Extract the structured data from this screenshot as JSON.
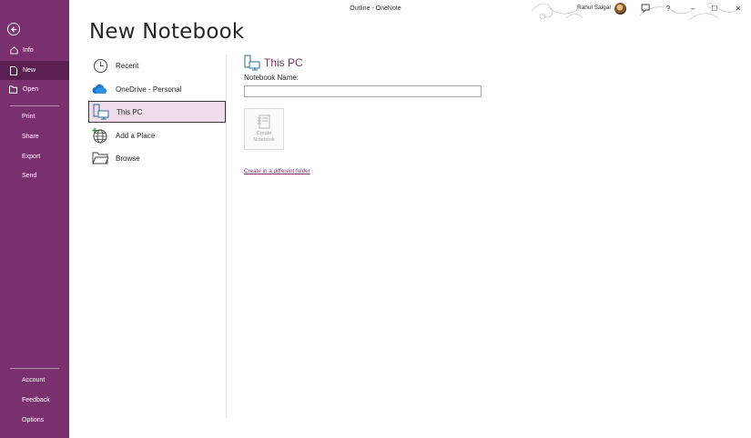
{
  "window": {
    "title": "Outline  -  OneNote",
    "user_name": "Rahul Saigal",
    "buttons": [
      "?",
      "–",
      "☐",
      "✕"
    ]
  },
  "colors": {
    "rail": "#7a306e",
    "rail_active": "#5a1f51",
    "accent": "#7a306e",
    "selected_bg": "#f0dbea"
  },
  "rail": {
    "top_items": [
      {
        "label": "Info",
        "icon": "info-icon"
      },
      {
        "label": "New",
        "icon": "new-document-icon",
        "active": true
      },
      {
        "label": "Open",
        "icon": "folder-open-icon"
      }
    ],
    "middle_items": [
      "Print",
      "Share",
      "Export",
      "Send"
    ],
    "bottom_items": [
      "Account",
      "Feedback",
      "Options"
    ]
  },
  "main": {
    "heading": "New Notebook",
    "locations": [
      {
        "label": "Recent",
        "icon": "clock-icon"
      },
      {
        "label": "OneDrive - Personal",
        "icon": "onedrive-cloud-icon"
      },
      {
        "label": "This PC",
        "icon": "computer-icon",
        "selected": true
      },
      {
        "label": "Add a Place",
        "icon": "globe-add-icon"
      },
      {
        "label": "Browse",
        "icon": "folder-icon"
      }
    ],
    "pane": {
      "title": "This PC",
      "field_label": "Notebook Name:",
      "notebook_name_value": "",
      "create_button": {
        "line1": "Create",
        "line2": "Notebook"
      },
      "different_folder_link": "Create in a different folder"
    }
  }
}
